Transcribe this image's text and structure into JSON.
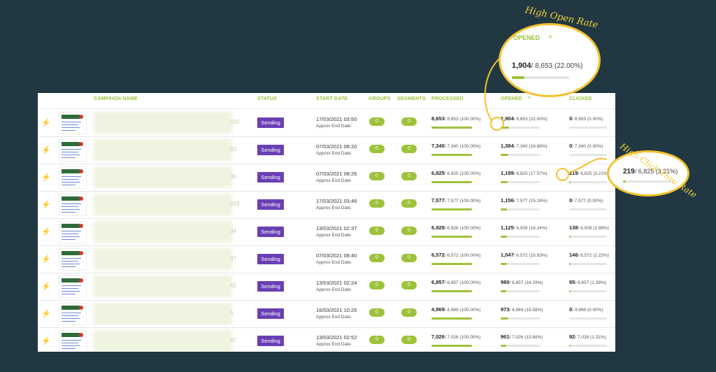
{
  "headers": {
    "campaign_name": "CAMPAIGN NAME",
    "status": "STATUS",
    "start_date": "START DATE",
    "groups": "GROUPS",
    "segments": "SEGMENTS",
    "processed": "PROCESSED",
    "opened": "OPENED",
    "clicked": "CLICKED",
    "opened_sort_icon": "chevron-up-icon"
  },
  "rows": [
    {
      "name_tail": "020",
      "status": "Sending",
      "date": "17/03/2021 03:50",
      "end_label": "Approx End Date:",
      "groups": "0",
      "segments": "0",
      "processed_main": "8,653",
      "processed_rest": "/ 8,653 (100.00%)",
      "processed_pct": 1.0,
      "opened_main": "1,904",
      "opened_rest": "/ 8,653 (22.00%)",
      "opened_pct": 0.22,
      "clicked_main": "0",
      "clicked_rest": "/ 8,653 (0.00%)",
      "clicked_pct": 0.0
    },
    {
      "name_tail": "03",
      "status": "Sending",
      "date": "07/03/2021 08:20",
      "end_label": "Approx End Date:",
      "groups": "0",
      "segments": "0",
      "processed_main": "7,340",
      "processed_rest": "/ 7,340 (100.00%)",
      "processed_pct": 1.0,
      "opened_main": "1,384",
      "opened_rest": "/ 7,340 (18.86%)",
      "opened_pct": 0.1886,
      "clicked_main": "0",
      "clicked_rest": "/ 7,340 (0.00%)",
      "clicked_pct": 0.0
    },
    {
      "name_tail": "36",
      "status": "Sending",
      "date": "07/03/2021 08:26",
      "end_label": "Approx End Date:",
      "groups": "0",
      "segments": "0",
      "processed_main": "6,825",
      "processed_rest": "/ 6,825 (100.00%)",
      "processed_pct": 1.0,
      "opened_main": "1,199",
      "opened_rest": "/ 6,825 (17.57%)",
      "opened_pct": 0.1757,
      "clicked_main": "219",
      "clicked_rest": "/ 6,825 (3.21%)",
      "clicked_pct": 0.0321
    },
    {
      "name_tail": "019",
      "status": "Sending",
      "date": "17/03/2021 03:46",
      "end_label": "Approx End Date:",
      "groups": "0",
      "segments": "0",
      "processed_main": "7,577",
      "processed_rest": "/ 7,577 (100.00%)",
      "processed_pct": 1.0,
      "opened_main": "1,156",
      "opened_rest": "/ 7,577 (15.26%)",
      "opened_pct": 0.1526,
      "clicked_main": "0",
      "clicked_rest": "/ 7,577 (0.00%)",
      "clicked_pct": 0.0
    },
    {
      "name_tail": "34",
      "status": "Sending",
      "date": "13/03/2021 02:37",
      "end_label": "Approx End Date:",
      "groups": "0",
      "segments": "0",
      "processed_main": "6,928",
      "processed_rest": "/ 6,928 (100.00%)",
      "processed_pct": 1.0,
      "opened_main": "1,125",
      "opened_rest": "/ 6,928 (16.24%)",
      "opened_pct": 0.1624,
      "clicked_main": "138",
      "clicked_rest": "/ 6,928 (1.99%)",
      "clicked_pct": 0.0199
    },
    {
      "name_tail": "37",
      "status": "Sending",
      "date": "07/03/2021 08:40",
      "end_label": "Approx End Date:",
      "groups": "0",
      "segments": "0",
      "processed_main": "6,572",
      "processed_rest": "/ 6,572 (100.00%)",
      "processed_pct": 1.0,
      "opened_main": "1,047",
      "opened_rest": "/ 6,572 (15.93%)",
      "opened_pct": 0.1593,
      "clicked_main": "146",
      "clicked_rest": "/ 6,572 (2.22%)",
      "clicked_pct": 0.0222
    },
    {
      "name_tail": "42",
      "status": "Sending",
      "date": "13/03/2021 02:24",
      "end_label": "Approx End Date:",
      "groups": "0",
      "segments": "0",
      "processed_main": "6,857",
      "processed_rest": "/ 6,857 (100.00%)",
      "processed_pct": 1.0,
      "opened_main": "980",
      "opened_rest": "/ 6,857 (14.29%)",
      "opened_pct": 0.1429,
      "clicked_main": "95",
      "clicked_rest": "/ 6,857 (1.39%)",
      "clicked_pct": 0.0139
    },
    {
      "name_tail": "5",
      "status": "Sending",
      "date": "16/03/2021 10:26",
      "end_label": "Approx End Date:",
      "groups": "0",
      "segments": "0",
      "processed_main": "4,969",
      "processed_rest": "/ 4,969 (100.00%)",
      "processed_pct": 1.0,
      "opened_main": "973",
      "opened_rest": "/ 4,969 (19.58%)",
      "opened_pct": 0.1958,
      "clicked_main": "0",
      "clicked_rest": "/ 4,969 (0.00%)",
      "clicked_pct": 0.0
    },
    {
      "name_tail": "47",
      "status": "Sending",
      "date": "13/03/2021 02:52",
      "end_label": "Approx End Date:",
      "groups": "0",
      "segments": "0",
      "processed_main": "7,026",
      "processed_rest": "/ 7,026 (100.00%)",
      "processed_pct": 1.0,
      "opened_main": "961",
      "opened_rest": "/ 7,026 (13.68%)",
      "opened_pct": 0.1368,
      "clicked_main": "92",
      "clicked_rest": "/ 7,026 (1.31%)",
      "clicked_pct": 0.0131
    }
  ],
  "callouts": {
    "open": {
      "label": "High Open Rate",
      "header": "OPENED",
      "main": "1,904",
      "rest": "/ 8,653 (22.00%)",
      "pct": 0.22
    },
    "click": {
      "label": "High Click-Thru Rate",
      "main": "219",
      "rest": "/ 6,825 (3.21%)",
      "pct": 0.0321
    }
  },
  "colors": {
    "accent": "#9dc23b",
    "status": "#6a3fb5",
    "highlight": "#f2c12e",
    "background": "#213742"
  }
}
